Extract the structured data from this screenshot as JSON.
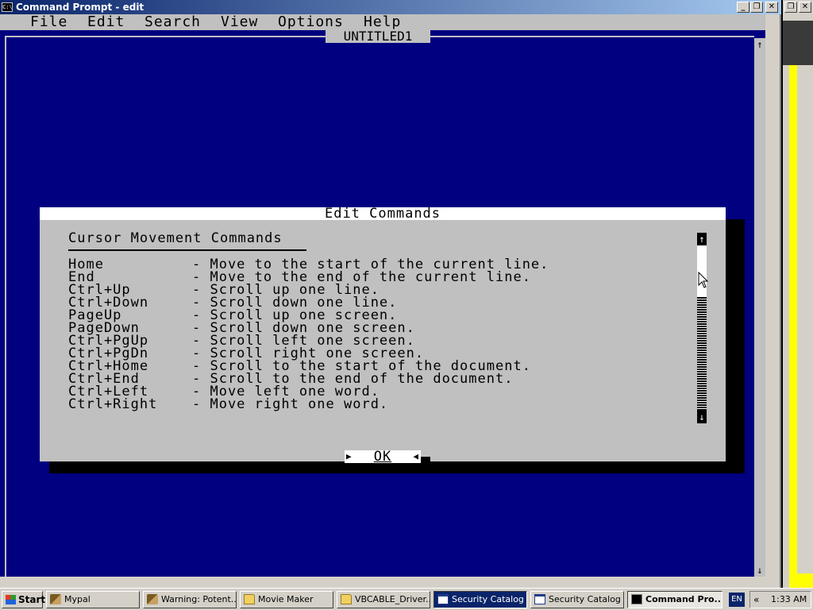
{
  "window": {
    "title": "Command Prompt - edit",
    "minimize": "_",
    "restore": "❐",
    "close": "✕",
    "icon_text": "C:\\"
  },
  "menubar": {
    "items": [
      "File",
      "Edit",
      "Search",
      "View",
      "Options",
      "Help"
    ]
  },
  "document": {
    "title": "UNTITLED1"
  },
  "editor_scroll": {
    "up": "↑",
    "down": "↓"
  },
  "dialog": {
    "title": "Edit Commands",
    "heading": "Cursor Movement Commands",
    "commands": [
      {
        "key": "Home",
        "desc": "- Move to the start of the current line."
      },
      {
        "key": "End",
        "desc": "- Move to the end of the current line."
      },
      {
        "key": "Ctrl+Up",
        "desc": "- Scroll up one line."
      },
      {
        "key": "Ctrl+Down",
        "desc": "- Scroll down one line."
      },
      {
        "key": "PageUp",
        "desc": "- Scroll up one screen."
      },
      {
        "key": "PageDown",
        "desc": "- Scroll down one screen."
      },
      {
        "key": "Ctrl+PgUp",
        "desc": "- Scroll left one screen."
      },
      {
        "key": "Ctrl+PgDn",
        "desc": "- Scroll right one screen."
      },
      {
        "key": "Ctrl+Home",
        "desc": "- Scroll to the start of the document."
      },
      {
        "key": "Ctrl+End",
        "desc": "- Scroll to the end of the document."
      },
      {
        "key": "Ctrl+Left",
        "desc": "- Move left one word."
      },
      {
        "key": "Ctrl+Right",
        "desc": "- Move right one word."
      }
    ],
    "scroll_up": "↑",
    "scroll_down": "↓",
    "ok_label": "OK"
  },
  "taskbar": {
    "start_label": "Start",
    "tasks": [
      {
        "label": "Mypal",
        "icon": "app-icon"
      },
      {
        "label": "Warning: Potent...",
        "icon": "warning-icon"
      },
      {
        "label": "Movie Maker",
        "icon": "folder-icon"
      },
      {
        "label": "VBCABLE_Driver...",
        "icon": "folder-icon"
      },
      {
        "label": "Security Catalog",
        "icon": "document-icon"
      },
      {
        "label": "Security Catalog",
        "icon": "document-icon"
      },
      {
        "label": "Command Pro...",
        "icon": "command-prompt-icon"
      }
    ],
    "language": "EN",
    "tray_chevron": "«",
    "clock": "1:33 AM"
  },
  "colors": {
    "console_background": "#000080",
    "dialog_background": "#c0c0c0",
    "title_bar": "#0a246a"
  }
}
